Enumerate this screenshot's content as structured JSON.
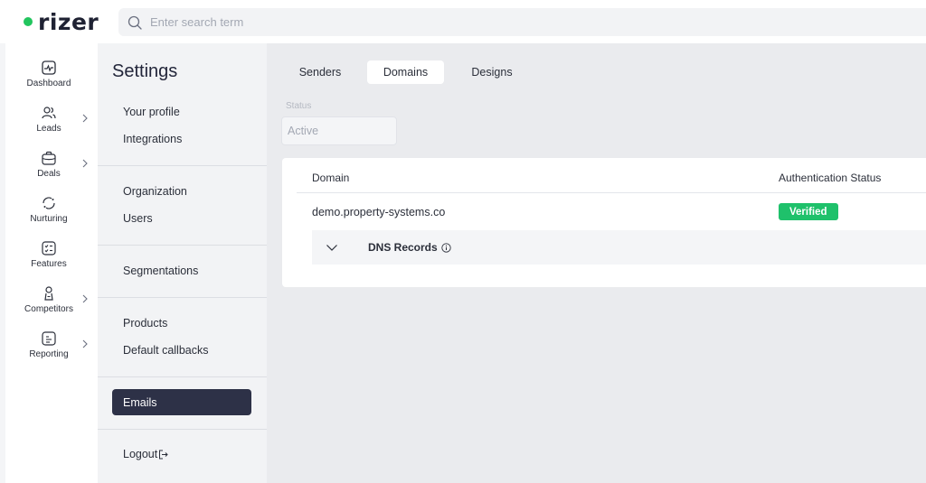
{
  "brand": {
    "name": "rizer",
    "dot_color": "#22c55e"
  },
  "search": {
    "placeholder": "Enter search term"
  },
  "nav": {
    "items": [
      {
        "label": "Dashboard",
        "icon": "monitor-pulse-icon",
        "has_chevron": false
      },
      {
        "label": "Leads",
        "icon": "users-icon",
        "has_chevron": true
      },
      {
        "label": "Deals",
        "icon": "briefcase-icon",
        "has_chevron": true
      },
      {
        "label": "Nurturing",
        "icon": "refresh-circle-icon",
        "has_chevron": false
      },
      {
        "label": "Features",
        "icon": "checklist-icon",
        "has_chevron": false
      },
      {
        "label": "Competitors",
        "icon": "person-icon",
        "has_chevron": true
      },
      {
        "label": "Reporting",
        "icon": "report-icon",
        "has_chevron": true
      }
    ]
  },
  "settings": {
    "title": "Settings",
    "groups": [
      [
        "Your profile",
        "Integrations"
      ],
      [
        "Organization",
        "Users"
      ],
      [
        "Segmentations"
      ],
      [
        "Products",
        "Default callbacks"
      ]
    ],
    "active_item": "Emails",
    "logout": "Logout"
  },
  "tabs": {
    "items": [
      "Senders",
      "Domains",
      "Designs"
    ],
    "active": "Domains"
  },
  "filter": {
    "status_label": "Status",
    "status_value": "Active"
  },
  "table": {
    "headers": {
      "domain": "Domain",
      "auth_status": "Authentication Status"
    },
    "rows": [
      {
        "domain": "demo.property-systems.co",
        "status": "Verified",
        "status_color": "#1fc16b"
      }
    ],
    "dns_records_label": "DNS Records"
  },
  "colors": {
    "active_bg": "#2d3147",
    "verified": "#1fc16b"
  }
}
